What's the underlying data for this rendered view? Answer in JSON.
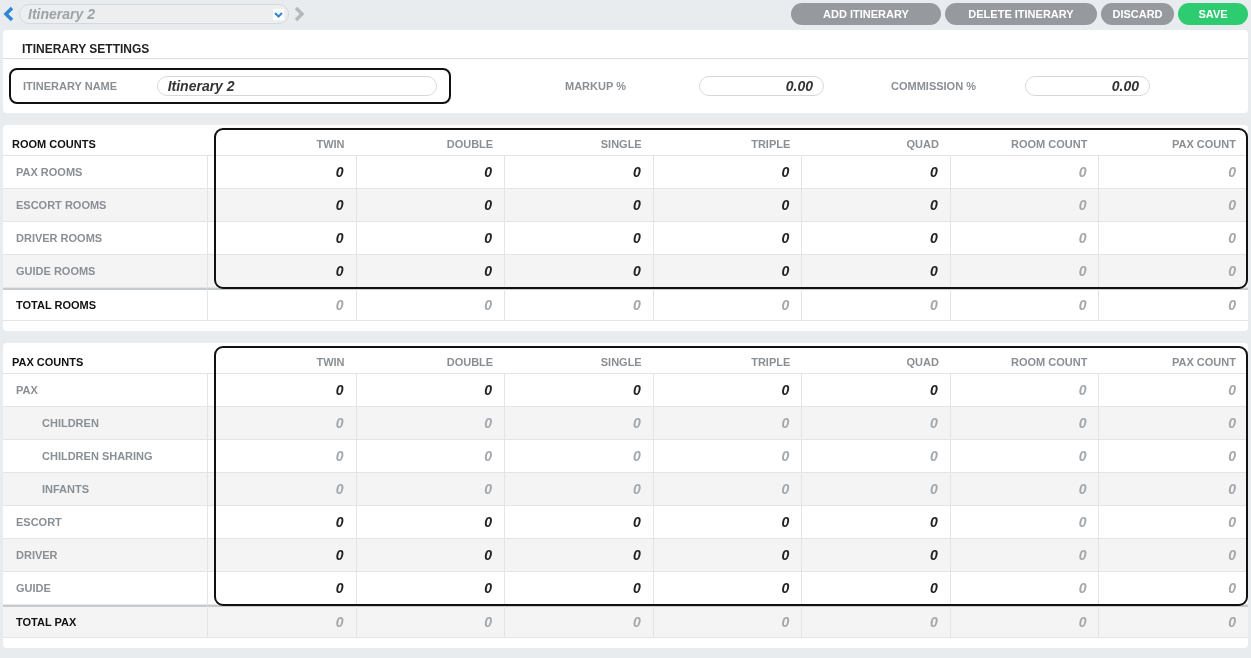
{
  "toolbar": {
    "itinerary_select": {
      "value": "Itinerary 2"
    },
    "buttons": [
      {
        "label": "ADD ITINERARY",
        "kind": "secondary"
      },
      {
        "label": "DELETE ITINERARY",
        "kind": "secondary"
      },
      {
        "label": "DISCARD",
        "kind": "secondary"
      },
      {
        "label": "SAVE",
        "kind": "primary"
      }
    ]
  },
  "settings": {
    "title": "ITINERARY SETTINGS",
    "name": {
      "label": "ITINERARY NAME",
      "value": "Itinerary 2",
      "highlighted": true
    },
    "markup": {
      "label": "MARKUP %",
      "value": "0.00"
    },
    "commission": {
      "label": "COMMISSION %",
      "value": "0.00"
    }
  },
  "tables": [
    {
      "title": "ROOM COUNTS",
      "highlighted": true,
      "columns": [
        {
          "label": "TWIN",
          "computed": false
        },
        {
          "label": "DOUBLE",
          "computed": false
        },
        {
          "label": "SINGLE",
          "computed": false
        },
        {
          "label": "TRIPLE",
          "computed": false
        },
        {
          "label": "QUAD",
          "computed": false
        },
        {
          "label": "ROOM COUNT",
          "computed": true
        },
        {
          "label": "PAX COUNT",
          "computed": true
        }
      ],
      "rows": [
        {
          "label": "PAX ROOMS",
          "editable": true,
          "values": [
            "0",
            "0",
            "0",
            "0",
            "0",
            "0",
            "0"
          ]
        },
        {
          "label": "ESCORT ROOMS",
          "editable": true,
          "values": [
            "0",
            "0",
            "0",
            "0",
            "0",
            "0",
            "0"
          ]
        },
        {
          "label": "DRIVER ROOMS",
          "editable": true,
          "values": [
            "0",
            "0",
            "0",
            "0",
            "0",
            "0",
            "0"
          ]
        },
        {
          "label": "GUIDE ROOMS",
          "editable": true,
          "values": [
            "0",
            "0",
            "0",
            "0",
            "0",
            "0",
            "0"
          ]
        }
      ],
      "total": {
        "label": "TOTAL ROOMS",
        "values": [
          "0",
          "0",
          "0",
          "0",
          "0",
          "0",
          "0"
        ]
      }
    },
    {
      "title": "PAX COUNTS",
      "highlighted": true,
      "columns": [
        {
          "label": "TWIN",
          "computed": false
        },
        {
          "label": "DOUBLE",
          "computed": false
        },
        {
          "label": "SINGLE",
          "computed": false
        },
        {
          "label": "TRIPLE",
          "computed": false
        },
        {
          "label": "QUAD",
          "computed": false
        },
        {
          "label": "ROOM COUNT",
          "computed": true
        },
        {
          "label": "PAX COUNT",
          "computed": true
        }
      ],
      "rows": [
        {
          "label": "PAX",
          "editable": true,
          "values": [
            "0",
            "0",
            "0",
            "0",
            "0",
            "0",
            "0"
          ],
          "children": [
            {
              "label": "CHILDREN",
              "editable": false,
              "values": [
                "0",
                "0",
                "0",
                "0",
                "0",
                "0",
                "0"
              ]
            },
            {
              "label": "CHILDREN SHARING",
              "editable": false,
              "values": [
                "0",
                "0",
                "0",
                "0",
                "0",
                "0",
                "0"
              ]
            },
            {
              "label": "INFANTS",
              "editable": false,
              "values": [
                "0",
                "0",
                "0",
                "0",
                "0",
                "0",
                "0"
              ]
            }
          ]
        },
        {
          "label": "ESCORT",
          "editable": true,
          "values": [
            "0",
            "0",
            "0",
            "0",
            "0",
            "0",
            "0"
          ]
        },
        {
          "label": "DRIVER",
          "editable": true,
          "values": [
            "0",
            "0",
            "0",
            "0",
            "0",
            "0",
            "0"
          ]
        },
        {
          "label": "GUIDE",
          "editable": true,
          "values": [
            "0",
            "0",
            "0",
            "0",
            "0",
            "0",
            "0"
          ]
        }
      ],
      "total": {
        "label": "TOTAL PAX",
        "values": [
          "0",
          "0",
          "0",
          "0",
          "0",
          "0",
          "0"
        ]
      }
    }
  ]
}
